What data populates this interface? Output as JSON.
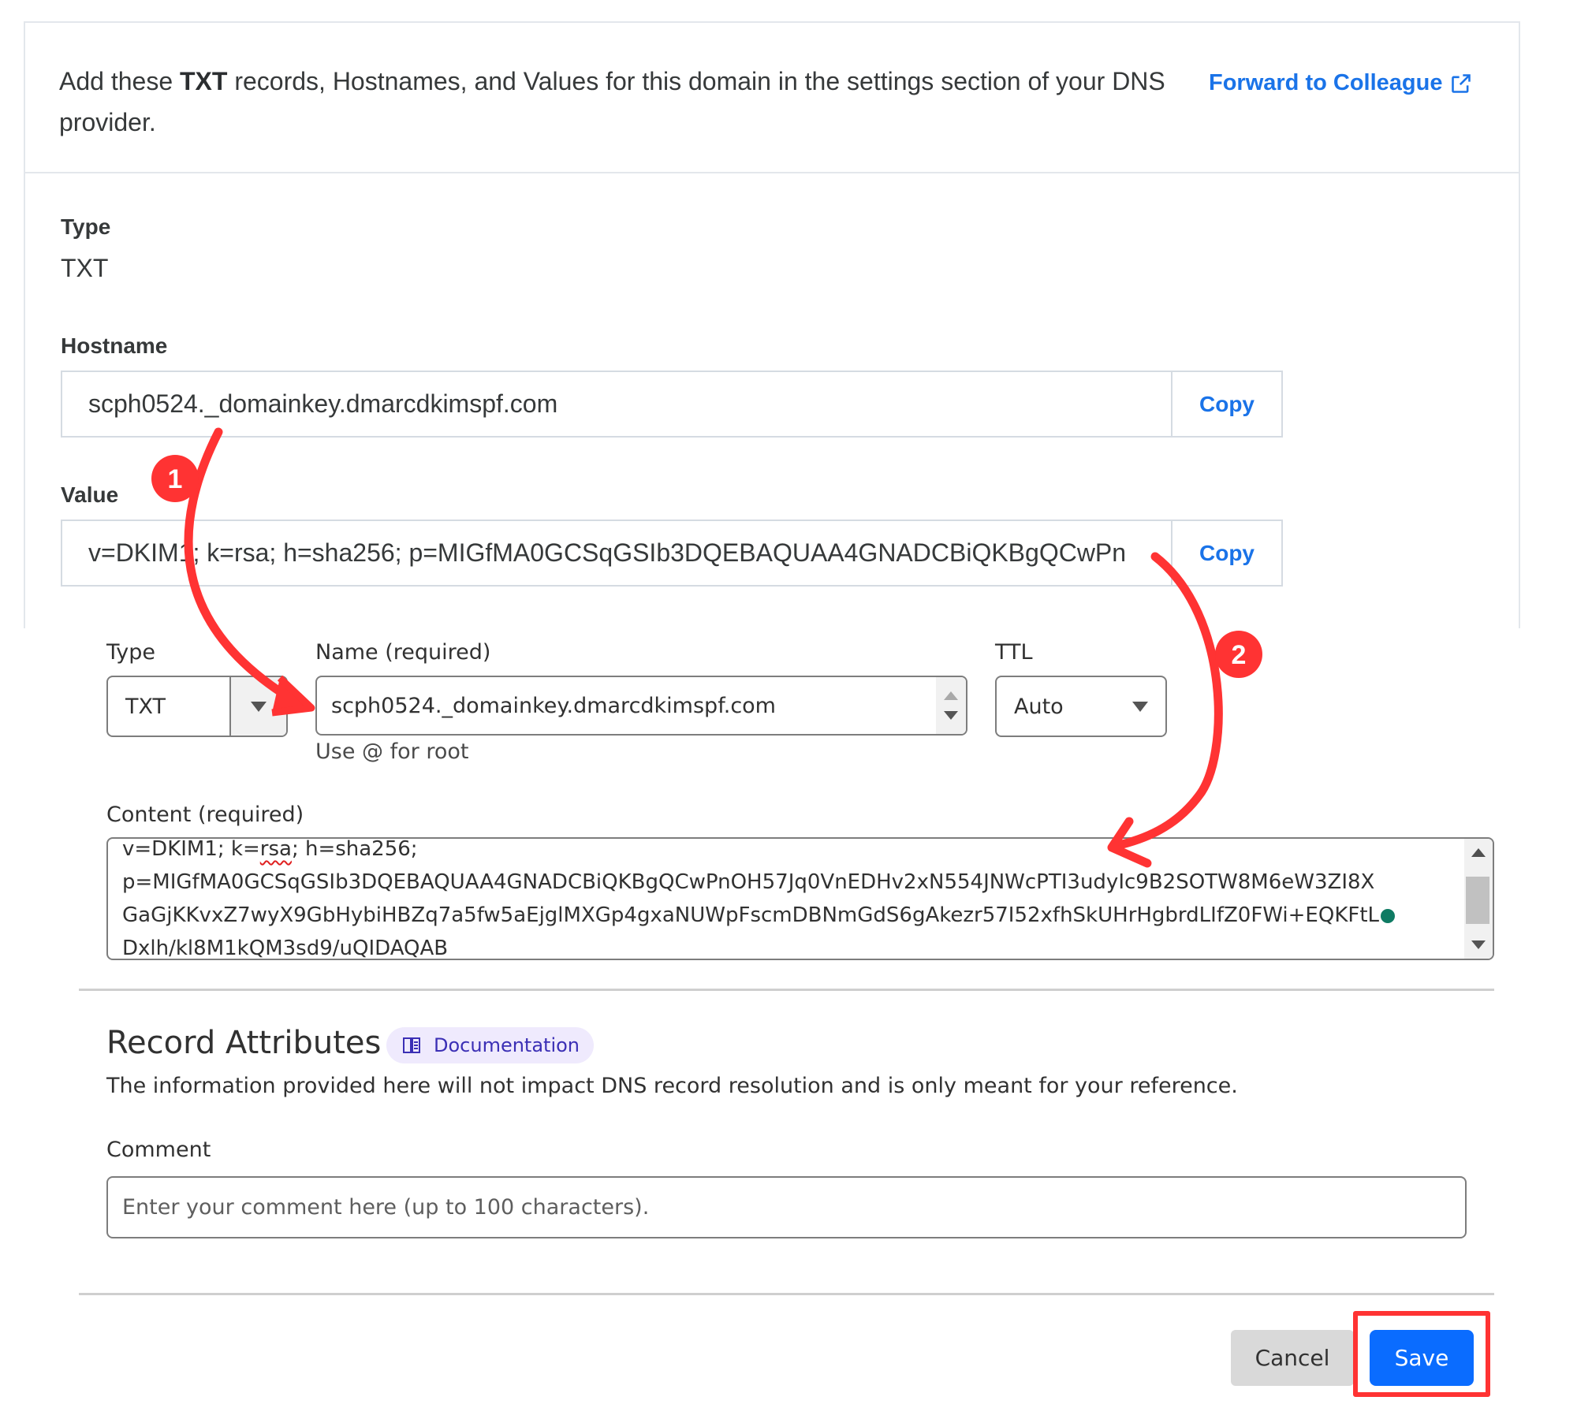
{
  "instructions": {
    "text_before": "Add these ",
    "text_bold": "TXT",
    "text_after": " records, Hostnames, and Values for this domain in the settings section of your DNS provider.",
    "forward_link": "Forward to Colleague",
    "forward_icon": "external-link-icon"
  },
  "record": {
    "type_label": "Type",
    "type_value": "TXT",
    "hostname_label": "Hostname",
    "hostname_value": "scph0524._domainkey.dmarcdkimspf.com",
    "value_label": "Value",
    "value_value": "v=DKIM1; k=rsa; h=sha256; p=MIGfMA0GCSqGSIb3DQEBAQUAA4GNADCBiQKBgQCwPn",
    "copy_label": "Copy"
  },
  "dns_form": {
    "type_label": "Type",
    "type_value": "TXT",
    "name_label": "Name (required)",
    "name_value": "scph0524._domainkey.dmarcdkimspf.com",
    "name_hint": "Use @ for root",
    "ttl_label": "TTL",
    "ttl_value": "Auto",
    "content_label": "Content (required)",
    "content_lines": {
      "l1_a": "v=DKIM1; k=",
      "l1_b": "rsa",
      "l1_c": "; h=sha256;",
      "l2": "p=MIGfMA0GCSqGSIb3DQEBAQUAA4GNADCBiQKBgQCwPnOH57Jq0VnEDHv2xN554JNWcPTI3udyIc9B2SOTW8M6eW3ZI8X",
      "l3": "GaGjKKvxZ7wyX9GbHybiHBZq7a5fw5aEjglMXGp4gxaNUWpFscmDBNmGdS6gAkezr57I52xfhSkUHrHgbrdLIfZ0FWi+EQKFtL",
      "l4_a": "Dxlh/kl8M1kQM3sd9/",
      "l4_b": "uQIDAQAB"
    }
  },
  "record_attributes": {
    "title": "Record Attributes",
    "doc_label": "Documentation",
    "description": "The information provided here will not impact DNS record resolution and is only meant for your reference.",
    "comment_label": "Comment",
    "comment_placeholder": "Enter your comment here (up to 100 characters).",
    "comment_value": ""
  },
  "actions": {
    "cancel_label": "Cancel",
    "save_label": "Save"
  },
  "annotations": {
    "step1": "1",
    "step2": "2",
    "color": "#ff3333"
  }
}
